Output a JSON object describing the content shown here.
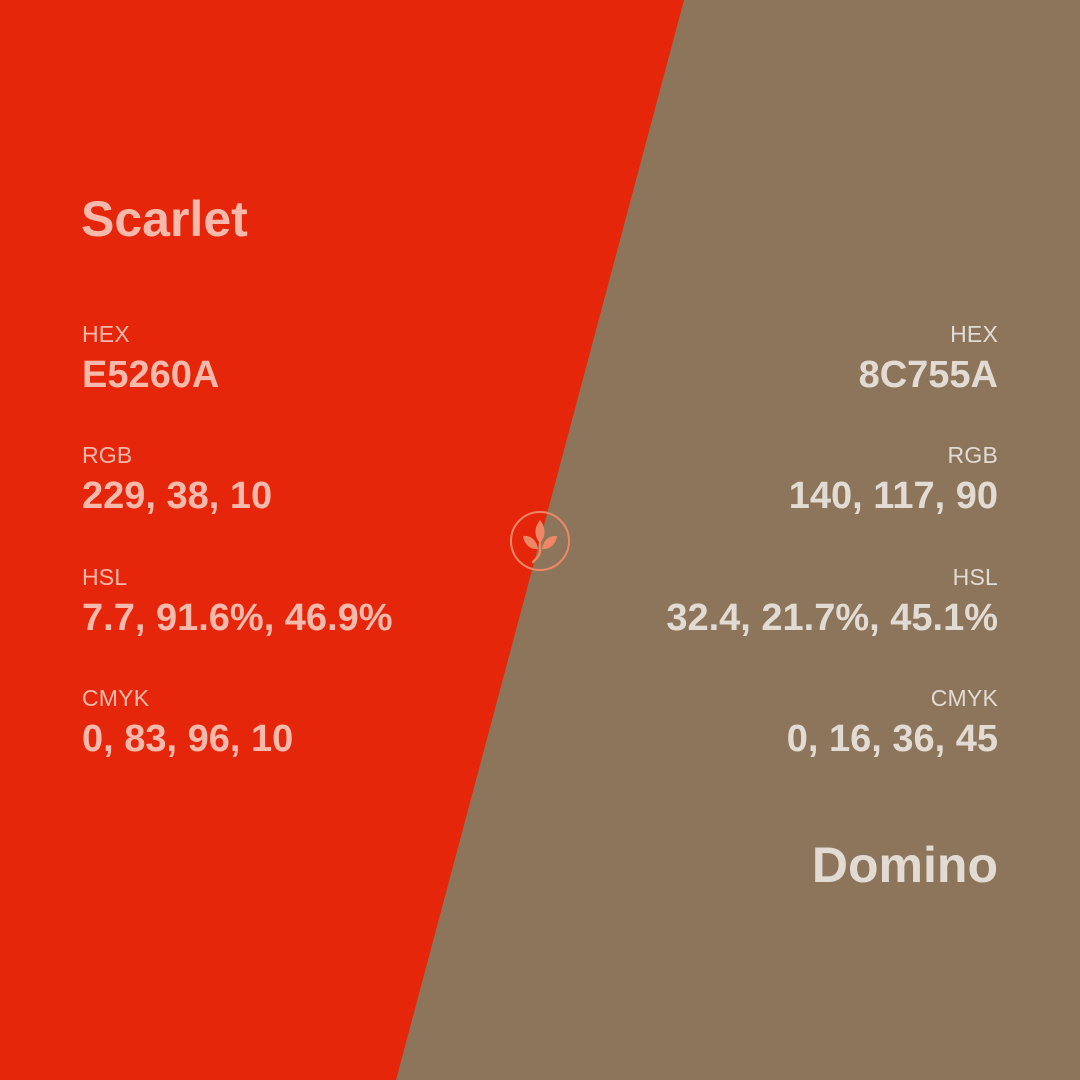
{
  "left": {
    "name": "Scarlet",
    "color": "#E5260A",
    "text_color": "#F6B9AB",
    "specs": [
      {
        "label": "HEX",
        "value": "E5260A"
      },
      {
        "label": "RGB",
        "value": "229, 38, 10"
      },
      {
        "label": "HSL",
        "value": "7.7, 91.6%, 46.9%"
      },
      {
        "label": "CMYK",
        "value": "0, 83, 96, 10"
      }
    ]
  },
  "right": {
    "name": "Domino",
    "color": "#8C755A",
    "text_color": "#E2DBD3",
    "specs": [
      {
        "label": "HEX",
        "value": "8C755A"
      },
      {
        "label": "RGB",
        "value": "140, 117, 90"
      },
      {
        "label": "HSL",
        "value": "32.4, 21.7%, 45.1%"
      },
      {
        "label": "CMYK",
        "value": "0, 16, 36, 45"
      }
    ]
  },
  "logo": {
    "icon": "leaf-sprout-icon",
    "color": "#EE8766"
  }
}
